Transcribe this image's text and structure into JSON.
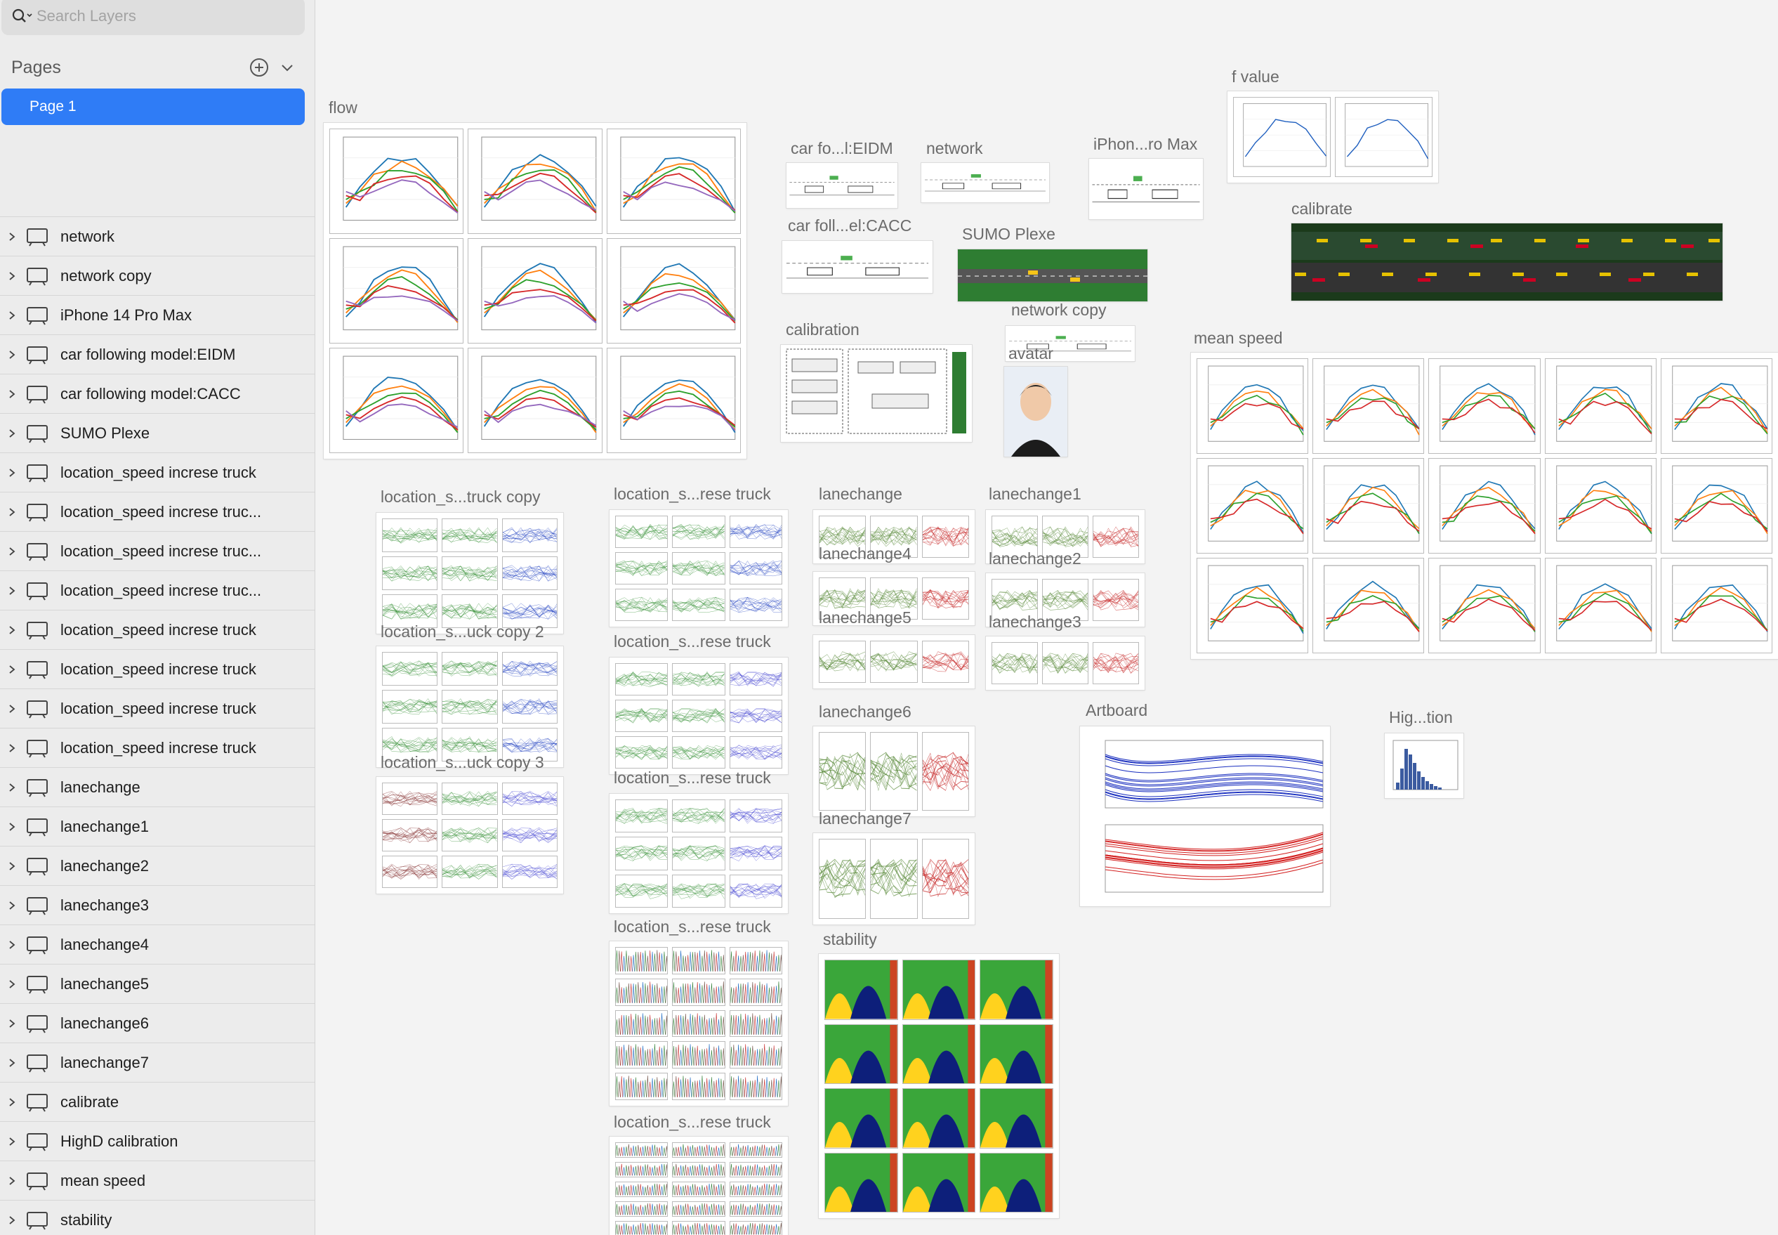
{
  "search": {
    "placeholder": "Search Layers"
  },
  "pages": {
    "title": "Pages",
    "items": [
      {
        "label": "Page 1"
      }
    ]
  },
  "layers": [
    {
      "name": "network"
    },
    {
      "name": "network copy"
    },
    {
      "name": "iPhone 14 Pro Max"
    },
    {
      "name": "car following model:EIDM"
    },
    {
      "name": "car following model:CACC"
    },
    {
      "name": "SUMO Plexe"
    },
    {
      "name": "location_speed increse truck"
    },
    {
      "name": "location_speed increse truc..."
    },
    {
      "name": "location_speed increse truc..."
    },
    {
      "name": "location_speed increse truc..."
    },
    {
      "name": "location_speed increse truck"
    },
    {
      "name": "location_speed increse truck"
    },
    {
      "name": "location_speed increse truck"
    },
    {
      "name": "location_speed increse truck"
    },
    {
      "name": "lanechange"
    },
    {
      "name": "lanechange1"
    },
    {
      "name": "lanechange2"
    },
    {
      "name": "lanechange3"
    },
    {
      "name": "lanechange4"
    },
    {
      "name": "lanechange5"
    },
    {
      "name": "lanechange6"
    },
    {
      "name": "lanechange7"
    },
    {
      "name": "calibrate"
    },
    {
      "name": "HighD calibration"
    },
    {
      "name": "mean speed"
    },
    {
      "name": "stability"
    }
  ],
  "canvas": {
    "artboards": [
      {
        "label": "flow"
      },
      {
        "label": "car fo...l:EIDM"
      },
      {
        "label": "network"
      },
      {
        "label": "iPhon...ro Max"
      },
      {
        "label": "f value"
      },
      {
        "label": "car foll...el:CACC"
      },
      {
        "label": "SUMO Plexe"
      },
      {
        "label": "calibrate"
      },
      {
        "label": "network copy"
      },
      {
        "label": "calibration"
      },
      {
        "label": "avatar"
      },
      {
        "label": "mean speed"
      },
      {
        "label": "location_s...truck copy"
      },
      {
        "label": "location_s...rese truck"
      },
      {
        "label": "lanechange"
      },
      {
        "label": "lanechange1"
      },
      {
        "label": "lanechange4"
      },
      {
        "label": "lanechange2"
      },
      {
        "label": "location_s...uck copy 2"
      },
      {
        "label": "lanechange5"
      },
      {
        "label": "lanechange3"
      },
      {
        "label": "location_s...rese truck"
      },
      {
        "label": "lanechange6"
      },
      {
        "label": "Artboard"
      },
      {
        "label": "Hig...tion"
      },
      {
        "label": "location_s...uck copy 3"
      },
      {
        "label": "location_s...rese truck"
      },
      {
        "label": "lanechange7"
      },
      {
        "label": "location_s...rese truck"
      },
      {
        "label": "stability"
      },
      {
        "label": "location_s...rese truck"
      }
    ]
  },
  "colors": {
    "accent": "#2f7cf6",
    "sidebar_bg": "#ececec",
    "canvas_bg": "#f3f3f3"
  }
}
